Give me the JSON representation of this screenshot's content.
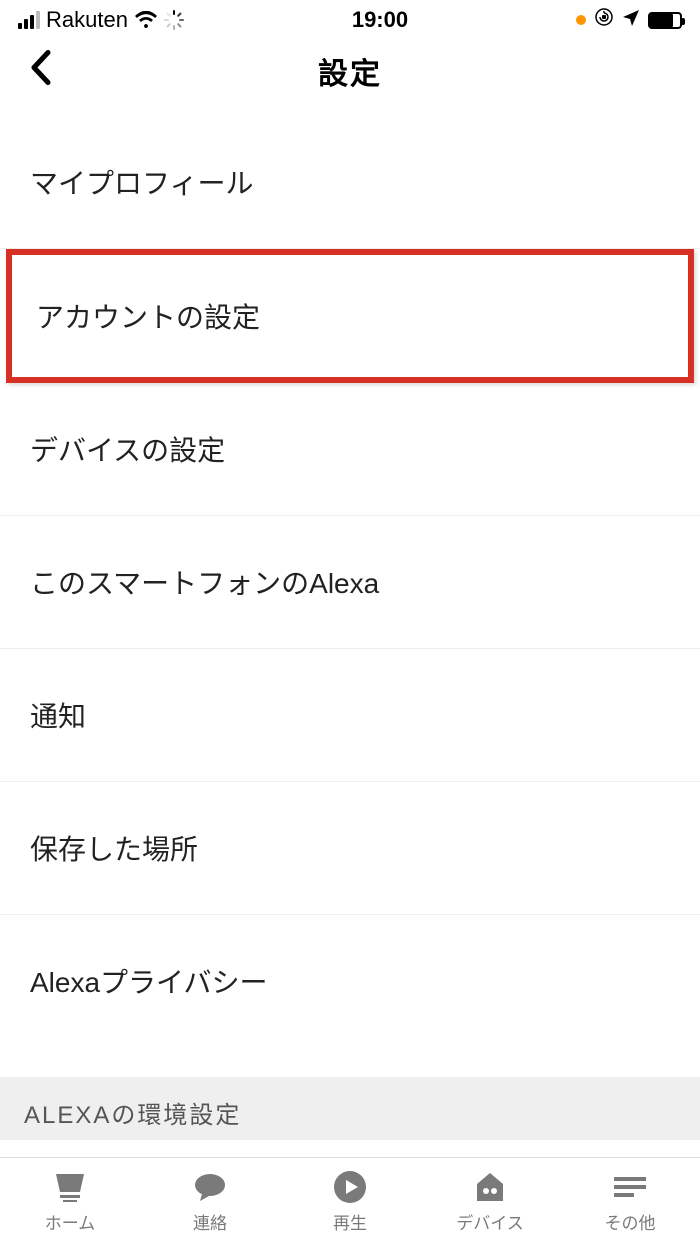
{
  "status": {
    "carrier": "Rakuten",
    "time": "19:00"
  },
  "nav": {
    "title": "設定"
  },
  "rows": {
    "profile": "マイプロフィール",
    "account": "アカウントの設定",
    "device": "デバイスの設定",
    "alexa_phone": "このスマートフォンのAlexa",
    "notifications": "通知",
    "saved_places": "保存した場所",
    "privacy": "Alexaプライバシー"
  },
  "section": {
    "env": "ALEXAの環境設定"
  },
  "tabs": {
    "home": "ホーム",
    "contacts": "連絡",
    "play": "再生",
    "devices": "デバイス",
    "more": "その他"
  }
}
